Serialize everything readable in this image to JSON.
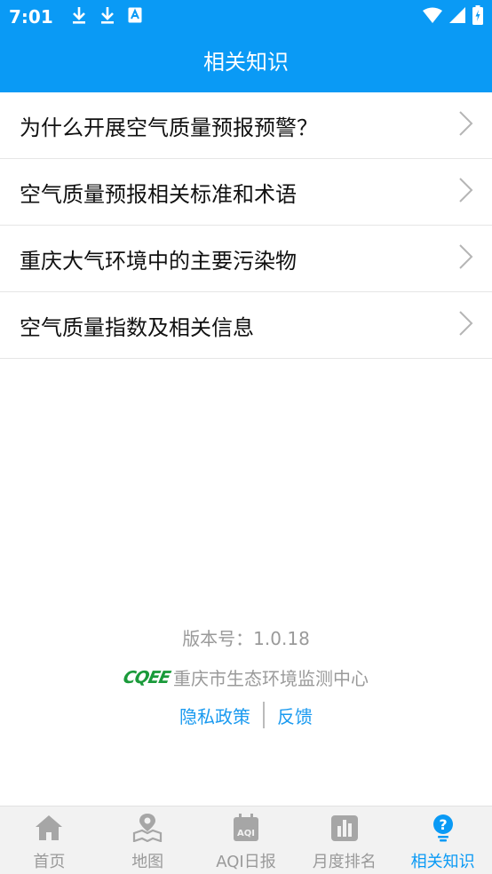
{
  "status": {
    "time": "7:01"
  },
  "header": {
    "title": "相关知识"
  },
  "items": [
    {
      "label": "为什么开展空气质量预报预警？"
    },
    {
      "label": "空气质量预报相关标准和术语"
    },
    {
      "label": "重庆大气环境中的主要污染物"
    },
    {
      "label": "空气质量指数及相关信息"
    }
  ],
  "footer": {
    "version": "版本号：1.0.18",
    "logo": "CQEE",
    "org": "重庆市生态环境监测中心",
    "privacy": "隐私政策",
    "feedback": "反馈"
  },
  "tabs": [
    {
      "label": "首页",
      "icon": "home-icon"
    },
    {
      "label": "地图",
      "icon": "map-icon"
    },
    {
      "label": "AQI日报",
      "icon": "calendar-icon",
      "badge": "AQI"
    },
    {
      "label": "月度排名",
      "icon": "bar-chart-icon"
    },
    {
      "label": "相关知识",
      "icon": "question-icon",
      "active": true
    }
  ],
  "colors": {
    "accent": "#0a9af5",
    "inactive": "#9a9a9a",
    "logo": "#1a9a3a"
  }
}
